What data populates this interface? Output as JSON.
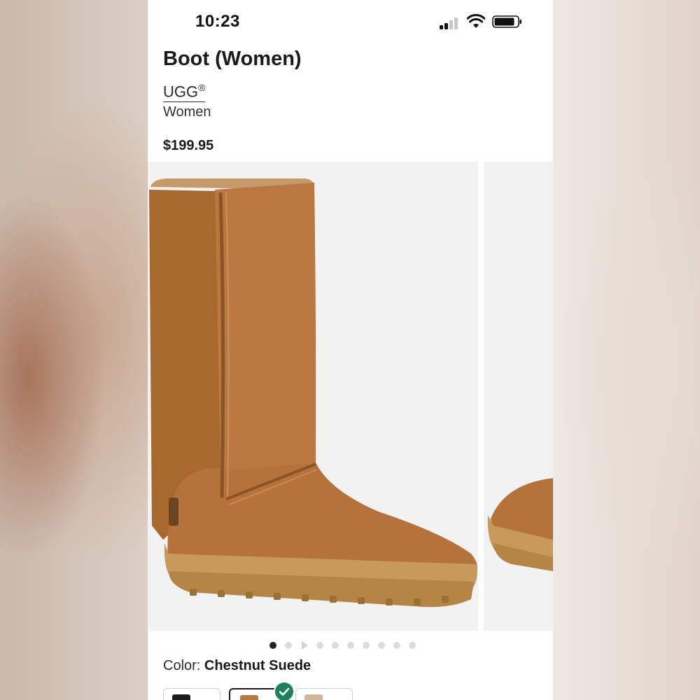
{
  "status_bar": {
    "time": "10:23",
    "signal_icon": "cellular-signal-icon",
    "wifi_icon": "wifi-icon",
    "battery_icon": "battery-icon"
  },
  "product": {
    "title": "Boot (Women)",
    "brand": "UGG",
    "brand_mark": "®",
    "category": "Women",
    "price": "$199.95"
  },
  "gallery": {
    "image_count": 10,
    "active_index": 0,
    "third_indicator_icon": "video-play-icon"
  },
  "color": {
    "label": "Color:",
    "selected": "Chestnut Suede"
  },
  "swatches": [
    {
      "name": "black",
      "color": "#1c1c1c",
      "selected": false
    },
    {
      "name": "chestnut",
      "color": "#b87a45",
      "selected": true
    },
    {
      "name": "sand",
      "color": "#cfb59a",
      "selected": false
    }
  ],
  "colors": {
    "accent_check": "#1c7f5e",
    "boot_suede": "#b9773f",
    "boot_sole": "#c79a5c"
  }
}
